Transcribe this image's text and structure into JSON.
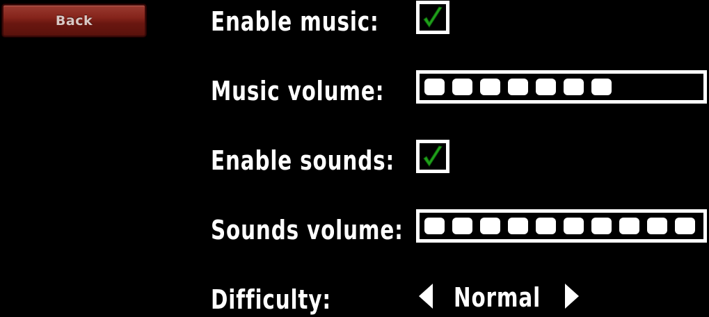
{
  "back_button": {
    "label": "Back"
  },
  "settings": {
    "enable_music": {
      "label": "Enable music:",
      "checked": true
    },
    "music_volume": {
      "label": "Music volume:",
      "level": 7,
      "max": 10
    },
    "enable_sounds": {
      "label": "Enable sounds:",
      "checked": true
    },
    "sounds_volume": {
      "label": "Sounds volume:",
      "level": 10,
      "max": 10
    },
    "difficulty": {
      "label": "Difficulty:",
      "value": "Normal"
    }
  },
  "icons": {
    "checkmark": "checkmark-icon",
    "arrow_left": "arrow-left-icon",
    "arrow_right": "arrow-right-icon"
  },
  "colors": {
    "background": "#000000",
    "text": "#ffffff",
    "checkmark": "#1fa01a",
    "button": "#85241b"
  }
}
